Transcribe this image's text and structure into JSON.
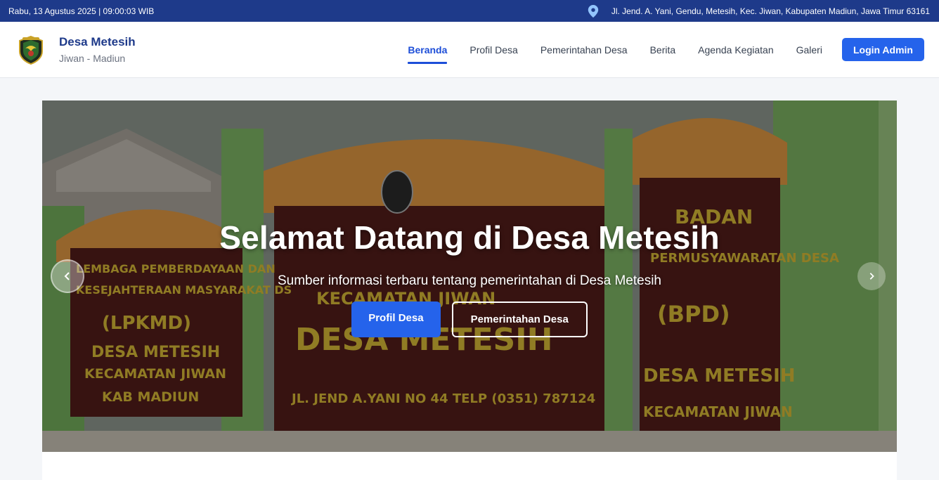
{
  "topbar": {
    "datetime": "Rabu, 13 Agustus 2025 | 09:00:03 WIB",
    "address": "Jl. Jend. A. Yani, Gendu, Metesih, Kec. Jiwan, Kabupaten Madiun, Jawa Timur 63161",
    "location_icon": "map-pin-icon"
  },
  "header": {
    "title": "Desa Metesih",
    "subtitle": "Jiwan - Madiun",
    "logo_icon": "village-emblem-icon"
  },
  "nav": {
    "items": [
      {
        "label": "Beranda",
        "active": true
      },
      {
        "label": "Profil Desa",
        "active": false
      },
      {
        "label": "Pemerintahan Desa",
        "active": false
      },
      {
        "label": "Berita",
        "active": false
      },
      {
        "label": "Agenda Kegiatan",
        "active": false
      },
      {
        "label": "Galeri",
        "active": false
      }
    ],
    "login_label": "Login Admin"
  },
  "hero": {
    "title": "Selamat Datang di Desa Metesih",
    "subtitle": "Sumber informasi terbaru tentang pemerintahan di Desa Metesih",
    "primary_button": "Profil Desa",
    "secondary_button": "Pemerintahan Desa",
    "prev_icon": "chevron-left-icon",
    "next_icon": "chevron-right-icon",
    "signs": {
      "left": [
        "LEMBAGA PEMBERDAYAAN DAN",
        "KESEJAHTERAAN MASYARAKAT DS",
        "(LPKMD)",
        "DESA METESIH",
        "KECAMATAN JIWAN",
        "KAB MADIUN"
      ],
      "center": [
        "KECAMATAN JIWAN",
        "DESA METESIH",
        "JL. JEND A.YANI NO 44 TELP (0351) 787124"
      ],
      "right": [
        "BADAN",
        "PERMUSYAWARATAN DESA",
        "(BPD)",
        "DESA METESIH",
        "KECAMATAN JIWAN"
      ]
    }
  },
  "colors": {
    "primary": "#2563eb",
    "navy": "#1e3a8a",
    "sign_yellow": "#e8c93a",
    "sign_maroon": "#5a1f1c"
  }
}
